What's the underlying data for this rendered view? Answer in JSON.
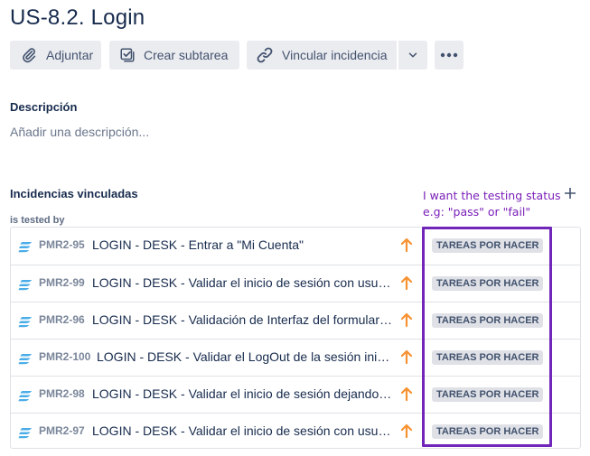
{
  "issue": {
    "title": "US-8.2. Login"
  },
  "toolbar": {
    "attach_label": "Adjuntar",
    "subtask_label": "Crear subtarea",
    "link_label": "Vincular incidencia"
  },
  "icons": {
    "attach": "paperclip-icon",
    "subtask": "checkbox-icon",
    "link": "link-icon",
    "dropdown": "chevron-down-icon",
    "more": "more-icon",
    "issue_type": "test-issue-icon",
    "priority": "priority-high-arrow-icon",
    "add": "plus-icon"
  },
  "colors": {
    "priority": "#f79232",
    "issue_icon": "#4bade8",
    "annotation": "#7026b9",
    "status_bg": "#dfe1e6"
  },
  "description": {
    "label": "Descripción",
    "placeholder": "Añadir una descripción..."
  },
  "linked": {
    "label": "Incidencias vinculadas",
    "relation": "is tested by",
    "items": [
      {
        "key": "PMR2-95",
        "summary": "LOGIN - DESK - Entrar a \"Mi Cuenta\"",
        "status": "TAREAS POR HACER"
      },
      {
        "key": "PMR2-99",
        "summary": "LOGIN - DESK - Validar el inicio de sesión con usuario válido",
        "status": "TAREAS POR HACER"
      },
      {
        "key": "PMR2-96",
        "summary": "LOGIN - DESK - Validación de Interfaz del formulario de login",
        "status": "TAREAS POR HACER"
      },
      {
        "key": "PMR2-100",
        "summary": "LOGIN - DESK - Validar el LogOut de la sesión iniciada",
        "status": "TAREAS POR HACER"
      },
      {
        "key": "PMR2-98",
        "summary": "LOGIN - DESK - Validar el inicio de sesión dejando campos vacíos",
        "status": "TAREAS POR HACER"
      },
      {
        "key": "PMR2-97",
        "summary": "LOGIN - DESK - Validar el inicio de sesión con usuario inválido",
        "status": "TAREAS POR HACER"
      }
    ]
  },
  "annotation": {
    "line1": "I want the testing status",
    "line2": "e.g: \"pass\" or \"fail\""
  }
}
